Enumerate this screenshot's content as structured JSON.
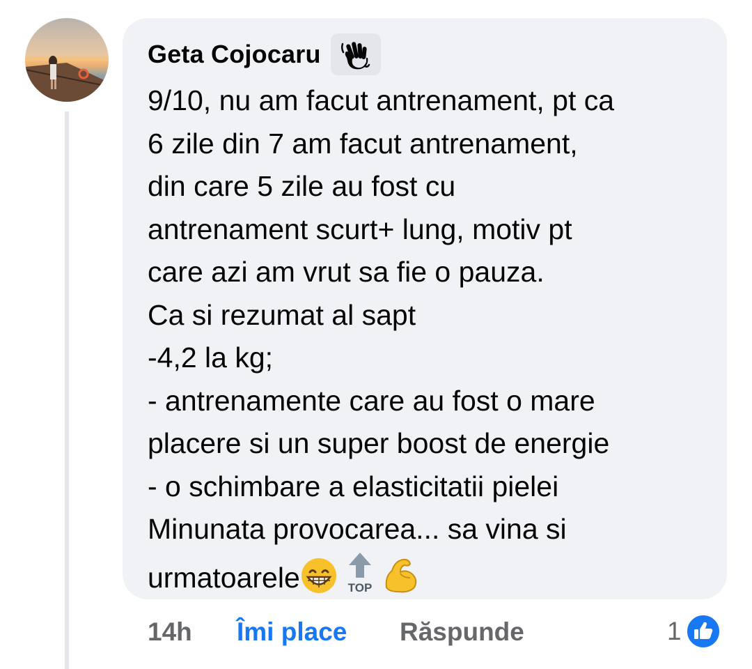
{
  "comment": {
    "author": "Geta Cojocaru",
    "author_badge_icon": "waving-hand-icon",
    "avatar_icon": "profile-photo-sunset-pier",
    "text": "9/10, nu am facut antrenament, pt ca\n6 zile din 7 am facut antrenament,\ndin care 5 zile au fost cu\nantrenament scurt+ lung, motiv pt\ncare azi am vrut sa fie o pauza.\nCa si rezumat al sapt\n-4,2 la kg;\n- antrenamente care au fost o mare\nplacere si un super boost de energie\n- o schimbare a elasticitatii pielei\nMinunata provocarea... sa vina si\nurmatoarele",
    "trailing_emojis": [
      "grinning-face-icon",
      "top-arrow-icon",
      "flexed-biceps-icon"
    ],
    "top_emoji_label": "TOP"
  },
  "actions": {
    "time": "14h",
    "like_label": "Îmi place",
    "reply_label": "Răspunde",
    "reaction_count": "1",
    "reaction_icon": "like-thumb-icon"
  },
  "colors": {
    "bubble_bg": "#f0f2f5",
    "text": "#050505",
    "secondary_text": "#65676b",
    "accent": "#1877f2"
  }
}
